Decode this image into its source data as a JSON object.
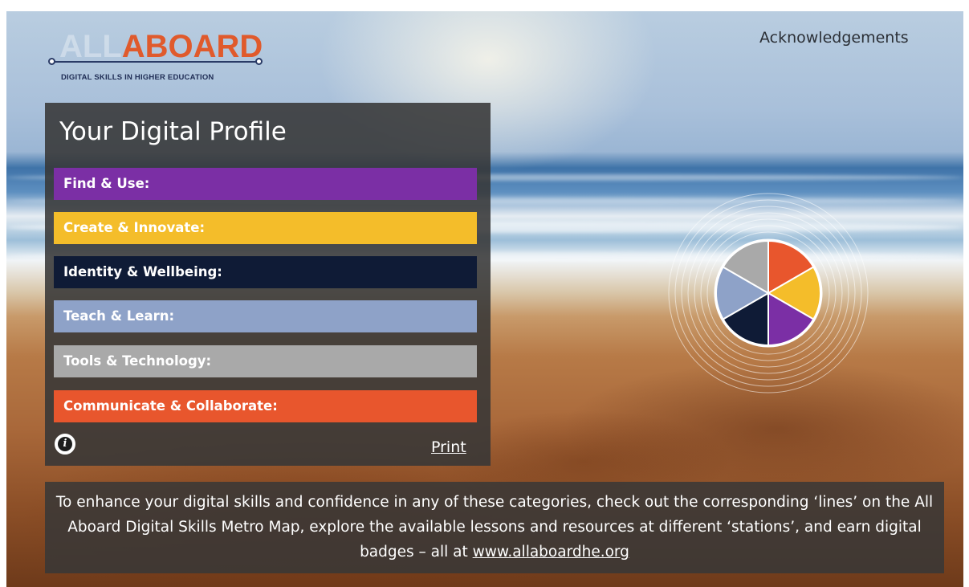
{
  "logo": {
    "word_all": "ALL",
    "word_aboard": "ABOARD",
    "tagline": "DIGITAL SKILLS IN HIGHER EDUCATION"
  },
  "header": {
    "acknowledgements_link": "Acknowledgements"
  },
  "profile": {
    "title": "Your Digital Profile",
    "categories": [
      {
        "label": "Find & Use:",
        "color": "#7b2fa5"
      },
      {
        "label": "Create & Innovate:",
        "color": "#f4bd2a"
      },
      {
        "label": "Identity & Wellbeing:",
        "color": "#0f1b36"
      },
      {
        "label": "Teach & Learn:",
        "color": "#8ea2c8"
      },
      {
        "label": "Tools & Technology:",
        "color": "#a9a9a9"
      },
      {
        "label": "Communicate & Collaborate:",
        "color": "#e8562d"
      }
    ],
    "info_icon": "info-icon",
    "print_link": "Print"
  },
  "wheel": {
    "segments": [
      {
        "category": "Communicate & Collaborate",
        "color": "#e8562d"
      },
      {
        "category": "Create & Innovate",
        "color": "#f4bd2a"
      },
      {
        "category": "Find & Use",
        "color": "#7b2fa5"
      },
      {
        "category": "Identity & Wellbeing",
        "color": "#0f1b36"
      },
      {
        "category": "Teach & Learn",
        "color": "#8ea2c8"
      },
      {
        "category": "Tools & Technology",
        "color": "#a9a9a9"
      }
    ]
  },
  "footer": {
    "text_before_link": "To enhance your digital skills and confidence in any of these categories, check out the corresponding ‘lines’ on the All Aboard Digital Skills Metro Map, explore the available lessons and resources at different ‘stations’, and earn digital badges – all at ",
    "link_text": "www.allaboardhe.org"
  }
}
